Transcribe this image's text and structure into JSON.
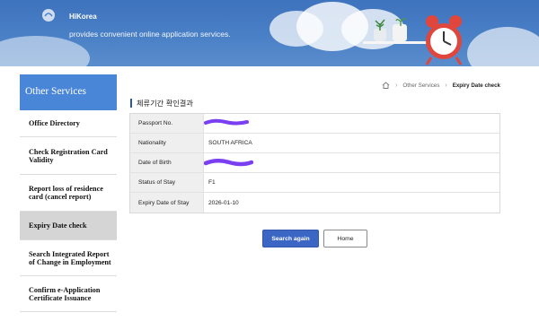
{
  "banner": {
    "brand": "HiKorea",
    "tagline": "provides convenient online application services."
  },
  "sidebar": {
    "title": "Other Services",
    "items": [
      {
        "label": "Office Directory",
        "active": false
      },
      {
        "label": "Check Registration Card Validity",
        "active": false
      },
      {
        "label": "Report loss of residence card (cancel report)",
        "active": false
      },
      {
        "label": "Expiry Date check",
        "active": true
      },
      {
        "label": "Search Integrated Report of Change in Employment",
        "active": false
      },
      {
        "label": "Confirm e-Application Certificate Issuance",
        "active": false
      }
    ]
  },
  "breadcrumb": {
    "home_icon": "home-icon",
    "items": [
      "Other Services",
      "Expiry Date check"
    ]
  },
  "section": {
    "title": "체류기간 확인결과"
  },
  "result_table": {
    "rows": [
      {
        "label": "Passport No.",
        "value": "",
        "redacted": true
      },
      {
        "label": "Nationality",
        "value": "SOUTH AFRICA",
        "redacted": false
      },
      {
        "label": "Date of Birth",
        "value": "",
        "redacted": true
      },
      {
        "label": "Status of Stay",
        "value": "F1",
        "redacted": false
      },
      {
        "label": "Expiry Date of Stay",
        "value": "2026-01-10",
        "redacted": false
      }
    ]
  },
  "buttons": {
    "search_again": "Search again",
    "home": "Home"
  },
  "colors": {
    "banner": "#4a80c6",
    "sidebar_title": "#4a86d8",
    "primary_button": "#3c66c4",
    "redaction": "#7b3ff2"
  }
}
